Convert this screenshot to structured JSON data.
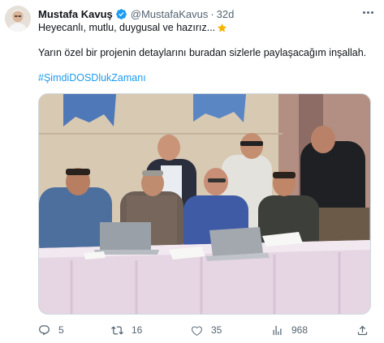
{
  "author": {
    "name": "Mustafa Kavuş",
    "handle": "@MustafaKavus",
    "separator": "·",
    "time": "32d"
  },
  "tweet": {
    "line1": "Heyecanlı, mutlu, duygusal ve hazırız...",
    "line2": "Yarın özel bir projenin detaylarını buradan sizlerle paylaşacağım inşallah.",
    "hashtag": "#ŞimdiDOSDlukZamanı"
  },
  "icons": {
    "verified": "verified-badge-icon",
    "star": "star-emoji-icon",
    "more": "more-options-icon",
    "reply": "reply-icon",
    "retweet": "retweet-icon",
    "like": "heart-icon",
    "views": "views-chart-icon",
    "share": "share-icon"
  },
  "actions": {
    "replies": "5",
    "retweets": "16",
    "likes": "35",
    "views": "968"
  },
  "colors": {
    "link": "#1d9bf0",
    "verified": "#1d9bf0",
    "secondary_text": "#536471",
    "star": "#f4b400"
  }
}
